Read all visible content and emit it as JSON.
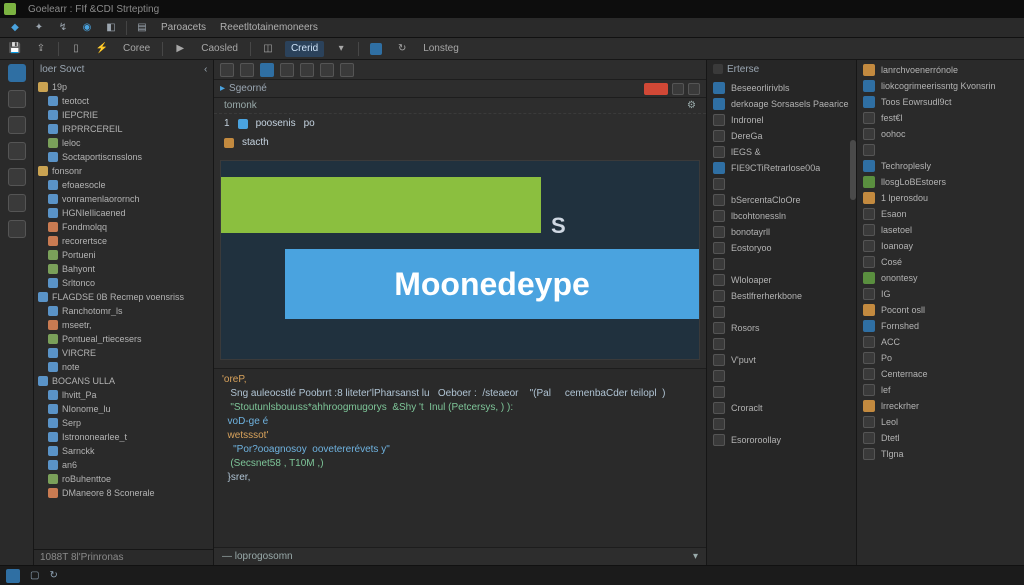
{
  "title": "Goelearr : FIf &CDI Strtepting",
  "menubar": [
    "Paroacets",
    "Reeetltotainemoneers"
  ],
  "toolbar": {
    "items": [
      "Coree",
      "Caosled",
      "Crerid",
      "Lonsteg"
    ]
  },
  "editorbar": {
    "run": "▶",
    "items": [
      "",
      "",
      "",
      ""
    ]
  },
  "breadcrumb": {
    "tab": "Sgeorné",
    "path": "tomonk"
  },
  "explorer": {
    "title": "loer  Sovct",
    "footer": "1088T 8l'Prinronas",
    "items": [
      {
        "icon": "folder",
        "label": "19p",
        "lv": 0
      },
      {
        "icon": "file",
        "label": "teotoct",
        "lv": 1
      },
      {
        "icon": "file",
        "label": "IEPCRIE",
        "lv": 1
      },
      {
        "icon": "file",
        "label": "IRPRRCEREIL",
        "lv": 1
      },
      {
        "icon": "cfg",
        "label": "leloc",
        "lv": 1
      },
      {
        "icon": "file",
        "label": "Soctaportiscnsslons",
        "lv": 1
      },
      {
        "icon": "folder",
        "label": "fonsonr",
        "lv": 0
      },
      {
        "icon": "file",
        "label": "efoaesocle",
        "lv": 1
      },
      {
        "icon": "file",
        "label": "vonramenlaorornch",
        "lv": 1
      },
      {
        "icon": "file",
        "label": "HGNIeIlicaened",
        "lv": 1
      },
      {
        "icon": "img",
        "label": "Fondmolqq",
        "lv": 1
      },
      {
        "icon": "img",
        "label": "recorertsce",
        "lv": 1
      },
      {
        "icon": "cfg",
        "label": "Portueni",
        "lv": 1
      },
      {
        "icon": "cfg",
        "label": "Bahyont",
        "lv": 1
      },
      {
        "icon": "file",
        "label": "Srltonco",
        "lv": 1
      },
      {
        "icon": "file",
        "label": "FLAGDSE 0B  Recmep voensriss",
        "lv": 0
      },
      {
        "icon": "file",
        "label": "Ranchotomr_ls",
        "lv": 1
      },
      {
        "icon": "img",
        "label": "mseetr,",
        "lv": 1
      },
      {
        "icon": "cfg",
        "label": "Pontueal_rtiecesers",
        "lv": 1
      },
      {
        "icon": "file",
        "label": "VIRCRE",
        "lv": 1
      },
      {
        "icon": "file",
        "label": "note",
        "lv": 1
      },
      {
        "icon": "file",
        "label": "BOCANS ULLA",
        "lv": 0
      },
      {
        "icon": "file",
        "label": "lhvitt_Pa",
        "lv": 1
      },
      {
        "icon": "file",
        "label": "NIonome_lu",
        "lv": 1
      },
      {
        "icon": "file",
        "label": "Serp",
        "lv": 1
      },
      {
        "icon": "file",
        "label": "Istrononearlee_t",
        "lv": 1
      },
      {
        "icon": "file",
        "label": "Sarnckk",
        "lv": 1
      },
      {
        "icon": "file",
        "label": "an6",
        "lv": 1
      },
      {
        "icon": "cfg",
        "label": "roBuhenttoe",
        "lv": 1
      },
      {
        "icon": "img",
        "label": "DManeore 8 Sconerale",
        "lv": 1
      }
    ]
  },
  "preview": {
    "brand": "Moonedeype",
    "s": "S"
  },
  "editor_head": {
    "col0": "1",
    "col1": "poosenis",
    "col2": "po"
  },
  "editor_sub": {
    "a": "stacth"
  },
  "code": [
    {
      "c": "k1",
      "t": "'oreP,"
    },
    {
      "c": "",
      "t": "   Sng auleocstlé Poobrrt :8 liteter'lPharsanst lu   Oeboer :  /steaeor    \"(Pal     cemenbaCder teilopl  )"
    },
    {
      "c": "k2",
      "t": "   \"Stoutunlsbouuss*ahhroogmugorys  &Shy 't  Inul (Petcersys, ) ):"
    },
    {
      "c": "k3",
      "t": "  voD-ge é "
    },
    {
      "c": "k1",
      "t": "  wetsssot'"
    },
    {
      "c": "k3",
      "t": "    \"Por?ooagnosoy  oovetererévets y\""
    },
    {
      "c": "k2",
      "t": "   (Secsnet58 , T10M ,)"
    },
    {
      "c": "",
      "t": "  }srer,"
    }
  ],
  "center_status": "— loprogosomn",
  "panel_outline": {
    "title": "Erterse",
    "items": [
      {
        "icon": "blue",
        "label": "Beseeorlirivbls"
      },
      {
        "icon": "blue",
        "label": "derkoage Sorsasels  Paearice"
      },
      {
        "icon": "",
        "label": "Indronel"
      },
      {
        "icon": "",
        "label": "DereGa"
      },
      {
        "icon": "",
        "label": "lEGS &"
      },
      {
        "icon": "blue",
        "label": "FIE9CTiRetrarlose00a"
      },
      {
        "icon": "",
        "label": ""
      },
      {
        "icon": "",
        "label": "bSercentaCloOre"
      },
      {
        "icon": "",
        "label": "lbcohtonessln"
      },
      {
        "icon": "",
        "label": "bonotayrll"
      },
      {
        "icon": "",
        "label": "Eostoryoo"
      },
      {
        "icon": "",
        "label": ""
      },
      {
        "icon": "",
        "label": "Wloloaper"
      },
      {
        "icon": "",
        "label": "Bestlfrerherkbone"
      },
      {
        "icon": "",
        "label": ""
      },
      {
        "icon": "",
        "label": "Rosors "
      },
      {
        "icon": "",
        "label": ""
      },
      {
        "icon": "",
        "label": "V'puvt"
      },
      {
        "icon": "",
        "label": ""
      },
      {
        "icon": "",
        "label": ""
      },
      {
        "icon": "",
        "label": "Croraclt"
      },
      {
        "icon": "",
        "label": ""
      },
      {
        "icon": "",
        "label": "Esororoollay"
      }
    ]
  },
  "panel_props": {
    "items": [
      {
        "icon": "orange",
        "label": "lanrchvoenerrónole"
      },
      {
        "icon": "blue",
        "label": "liokcogrimeerissntg Kvonsrin"
      },
      {
        "icon": "blue",
        "label": "Toos Eowrsudl9ct"
      },
      {
        "icon": "",
        "label": "fest€l"
      },
      {
        "icon": "",
        "label": "oohoc"
      },
      {
        "icon": "",
        "label": ""
      },
      {
        "icon": "blue",
        "label": "Techroplesly"
      },
      {
        "icon": "green",
        "label": "llosgLoBEstoers"
      },
      {
        "icon": "orange",
        "label": "1 lperosdou"
      },
      {
        "icon": "",
        "label": "Esaon"
      },
      {
        "icon": "",
        "label": "lasetoel"
      },
      {
        "icon": "",
        "label": "Ioanoay"
      },
      {
        "icon": "",
        "label": "Cosé"
      },
      {
        "icon": "green",
        "label": "onontesy"
      },
      {
        "icon": "",
        "label": "IG"
      },
      {
        "icon": "orange",
        "label": "Pocont osll"
      },
      {
        "icon": "blue",
        "label": "Fornshed"
      },
      {
        "icon": "",
        "label": "ACC"
      },
      {
        "icon": "",
        "label": "Po"
      },
      {
        "icon": "",
        "label": "Centernace"
      },
      {
        "icon": "",
        "label": "lef"
      },
      {
        "icon": "orange",
        "label": "lrreckrher"
      },
      {
        "icon": "",
        "label": "Leol"
      },
      {
        "icon": "",
        "label": "Dtetl"
      },
      {
        "icon": "",
        "label": "Tlgna"
      }
    ]
  },
  "colors": {
    "accent": "#4aa3df",
    "brand_green": "#8bbf3f"
  }
}
